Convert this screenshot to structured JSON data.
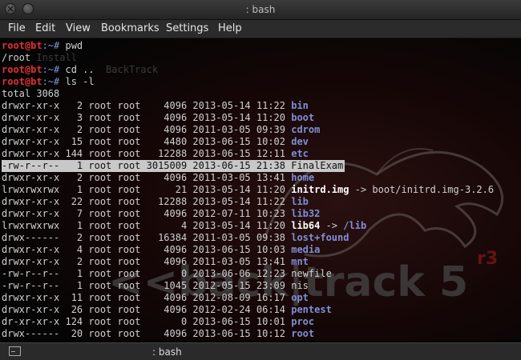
{
  "window": {
    "title": ": bash"
  },
  "menu": [
    "File",
    "Edit",
    "View",
    "Bookmarks",
    "Settings",
    "Help"
  ],
  "terminal": {
    "prompt_user": "root@bt",
    "prompt_sep": ":~# ",
    "commands": [
      "pwd",
      "cd ..",
      "ls -l"
    ],
    "pwd_output": "/root",
    "background_ghost": [
      "Install",
      "BackTrack"
    ],
    "total": "total 3068",
    "listing": [
      {
        "perm": "drwxr-xr-x",
        "links": "2",
        "owner": "root",
        "group": "root",
        "size": "4096",
        "date": "2013-05-14",
        "time": "11:22",
        "name": "bin",
        "type": "dir"
      },
      {
        "perm": "drwxr-xr-x",
        "links": "3",
        "owner": "root",
        "group": "root",
        "size": "4096",
        "date": "2013-05-14",
        "time": "11:20",
        "name": "boot",
        "type": "dir"
      },
      {
        "perm": "drwxr-xr-x",
        "links": "2",
        "owner": "root",
        "group": "root",
        "size": "4096",
        "date": "2011-03-05",
        "time": "09:39",
        "name": "cdrom",
        "type": "dir"
      },
      {
        "perm": "drwxr-xr-x",
        "links": "15",
        "owner": "root",
        "group": "root",
        "size": "4480",
        "date": "2013-06-15",
        "time": "10:02",
        "name": "dev",
        "type": "dir"
      },
      {
        "perm": "drwxr-xr-x",
        "links": "144",
        "owner": "root",
        "group": "root",
        "size": "12288",
        "date": "2013-06-15",
        "time": "12:11",
        "name": "etc",
        "type": "dir"
      },
      {
        "perm": "-rw-r--r--",
        "links": "1",
        "owner": "root",
        "group": "root",
        "size": "3015009",
        "date": "2013-06-15",
        "time": "21:38",
        "name": "FinalExam",
        "type": "file",
        "selected": true
      },
      {
        "perm": "drwxr-xr-x",
        "links": "2",
        "owner": "root",
        "group": "root",
        "size": "4096",
        "date": "2011-03-05",
        "time": "13:41",
        "name": "home",
        "type": "dir"
      },
      {
        "perm": "lrwxrwxrwx",
        "links": "1",
        "owner": "root",
        "group": "root",
        "size": "21",
        "date": "2013-05-14",
        "time": "11:20",
        "name": "initrd.img",
        "type": "link",
        "target": " -> boot/initrd.img-3.2.6"
      },
      {
        "perm": "drwxr-xr-x",
        "links": "22",
        "owner": "root",
        "group": "root",
        "size": "12288",
        "date": "2013-05-14",
        "time": "11:22",
        "name": "lib",
        "type": "dir"
      },
      {
        "perm": "drwxr-xr-x",
        "links": "7",
        "owner": "root",
        "group": "root",
        "size": "4096",
        "date": "2012-07-11",
        "time": "10:23",
        "name": "lib32",
        "type": "dir"
      },
      {
        "perm": "lrwxrwxrwx",
        "links": "1",
        "owner": "root",
        "group": "root",
        "size": "4",
        "date": "2013-05-14",
        "time": "11:20",
        "name": "lib64",
        "type": "link",
        "target": " -> ",
        "target_dir": "/lib"
      },
      {
        "perm": "drwx------",
        "links": "2",
        "owner": "root",
        "group": "root",
        "size": "16384",
        "date": "2011-03-05",
        "time": "09:38",
        "name": "lost+found",
        "type": "dir"
      },
      {
        "perm": "drwxr-xr-x",
        "links": "4",
        "owner": "root",
        "group": "root",
        "size": "4096",
        "date": "2013-06-15",
        "time": "10:03",
        "name": "media",
        "type": "dir"
      },
      {
        "perm": "drwxr-xr-x",
        "links": "2",
        "owner": "root",
        "group": "root",
        "size": "4096",
        "date": "2011-03-05",
        "time": "13:41",
        "name": "mnt",
        "type": "dir"
      },
      {
        "perm": "-rw-r--r--",
        "links": "1",
        "owner": "root",
        "group": "root",
        "size": "0",
        "date": "2013-06-06",
        "time": "12:23",
        "name": "newfile",
        "type": "file"
      },
      {
        "perm": "-rw-r--r--",
        "links": "1",
        "owner": "root",
        "group": "root",
        "size": "1045",
        "date": "2012-05-15",
        "time": "23:09",
        "name": "nis",
        "type": "file"
      },
      {
        "perm": "drwxr-xr-x",
        "links": "11",
        "owner": "root",
        "group": "root",
        "size": "4096",
        "date": "2012-08-09",
        "time": "16:17",
        "name": "opt",
        "type": "dir"
      },
      {
        "perm": "drwxr-xr-x",
        "links": "26",
        "owner": "root",
        "group": "root",
        "size": "4096",
        "date": "2012-02-24",
        "time": "06:14",
        "name": "pentest",
        "type": "dir"
      },
      {
        "perm": "dr-xr-xr-x",
        "links": "124",
        "owner": "root",
        "group": "root",
        "size": "0",
        "date": "2013-06-15",
        "time": "10:01",
        "name": "proc",
        "type": "dir"
      },
      {
        "perm": "drwx------",
        "links": "20",
        "owner": "root",
        "group": "root",
        "size": "4096",
        "date": "2013-06-15",
        "time": "10:12",
        "name": "root",
        "type": "dir"
      }
    ]
  },
  "wallpaper": {
    "text": "<<back|track 5",
    "superscript": "r3"
  },
  "status": {
    "tab_label": ": bash"
  },
  "colors": {
    "prompt_user": "#e03030",
    "directory": "#7f8fd6",
    "selection": "#c8c8c8"
  }
}
